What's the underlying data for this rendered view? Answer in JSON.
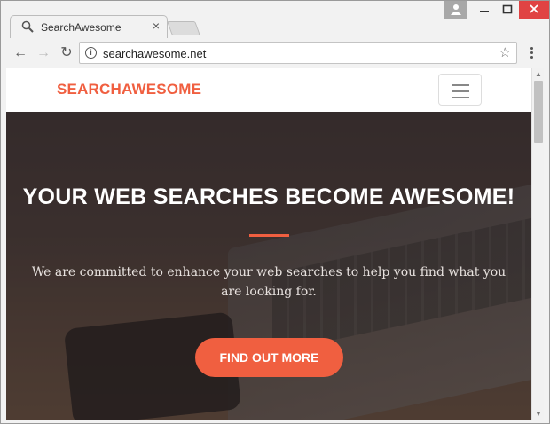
{
  "browser": {
    "tab_title": "SearchAwesome",
    "tab_close": "×",
    "url": "searchawesome.net",
    "nav": {
      "back": "←",
      "forward": "→",
      "reload": "↻",
      "star": "☆",
      "info": "i"
    },
    "window_controls": {
      "minimize": "–",
      "maximize": "□",
      "close": "✕",
      "user": "👤"
    }
  },
  "site": {
    "brand": "SEARCHAWESOME",
    "hero": {
      "title": "YOUR WEB SEARCHES BECOME AWESOME!",
      "text": "We are committed to enhance your web searches to help you find what you are looking for.",
      "cta": "FIND OUT MORE"
    },
    "accent_color": "#f05f40"
  },
  "scrollbar": {
    "up": "▲",
    "down": "▼"
  }
}
